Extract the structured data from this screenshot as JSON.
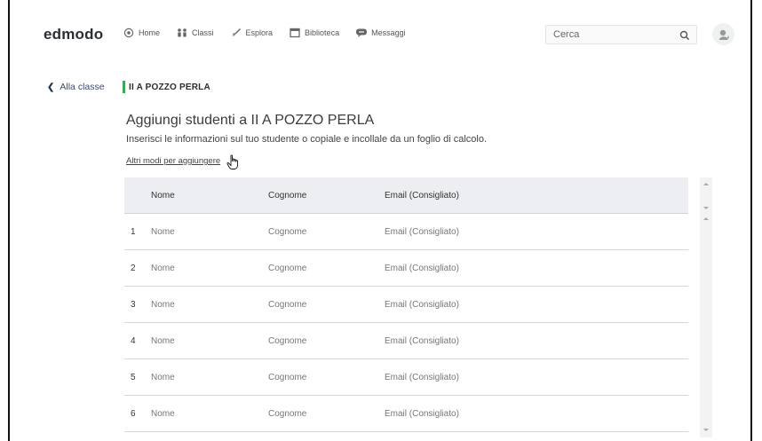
{
  "header": {
    "logo": "edmodo",
    "nav": [
      {
        "label": "Home",
        "icon": "home-icon"
      },
      {
        "label": "Classi",
        "icon": "classes-icon"
      },
      {
        "label": "Esplora",
        "icon": "rocket-icon"
      },
      {
        "label": "Biblioteca",
        "icon": "library-icon"
      },
      {
        "label": "Messaggi",
        "icon": "messages-icon"
      }
    ],
    "search_placeholder": "Cerca"
  },
  "back_label": "Alla classe",
  "class_name": "II A POZZO PERLA",
  "page": {
    "title": "Aggiungi studenti a II A POZZO PERLA",
    "subtitle": "Inserisci le informazioni sul tuo studente o copiale e incollale da un foglio di calcolo.",
    "other_ways": "Altri modi per aggiungere"
  },
  "table": {
    "columns": [
      "Nome",
      "Cognome",
      "Email (Consigliato)"
    ],
    "rows": [
      {
        "index": "1",
        "first": "Nome",
        "last": "Cognome",
        "email": "Email (Consigliato)"
      },
      {
        "index": "2",
        "first": "Nome",
        "last": "Cognome",
        "email": "Email (Consigliato)"
      },
      {
        "index": "3",
        "first": "Nome",
        "last": "Cognome",
        "email": "Email (Consigliato)"
      },
      {
        "index": "4",
        "first": "Nome",
        "last": "Cognome",
        "email": "Email (Consigliato)"
      },
      {
        "index": "5",
        "first": "Nome",
        "last": "Cognome",
        "email": "Email (Consigliato)"
      },
      {
        "index": "6",
        "first": "Nome",
        "last": "Cognome",
        "email": "Email (Consigliato)"
      }
    ]
  },
  "colors": {
    "accent_green": "#3ba757",
    "header_bg": "#eceef1"
  }
}
